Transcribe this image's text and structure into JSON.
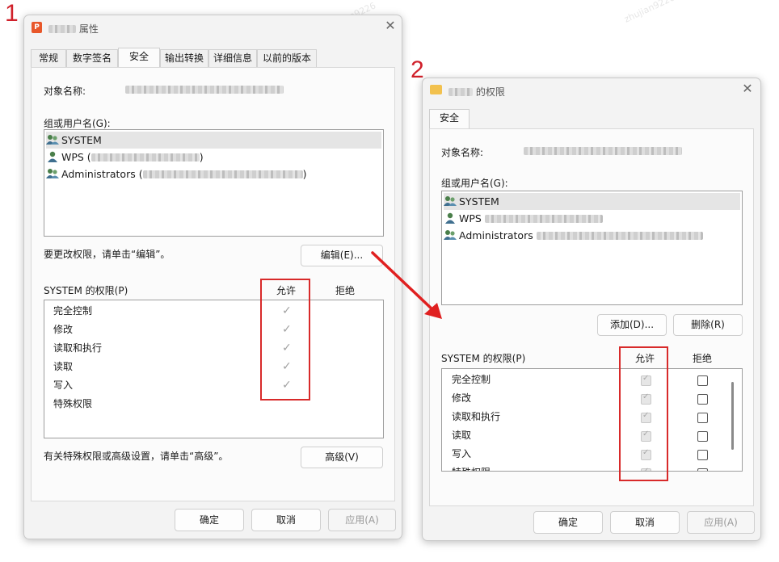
{
  "markers": {
    "one": "1",
    "two": "2"
  },
  "watermark": "zhujian9226",
  "colors": {
    "annotation_red": "#d82a2a",
    "arrow_red": "#e02020"
  },
  "window1": {
    "title_suffix": "属性",
    "tabs": [
      "常规",
      "数字签名",
      "安全",
      "输出转换",
      "详细信息",
      "以前的版本"
    ],
    "active_tab": "安全",
    "object_name_label": "对象名称:",
    "group_label": "组或用户名(G):",
    "users": [
      {
        "name": "SYSTEM",
        "icon": "group-users-icon"
      },
      {
        "name": "WPS (",
        "icon": "user-icon"
      },
      {
        "name": "Administrators (",
        "icon": "group-users-icon"
      }
    ],
    "admins_close": ")",
    "wps_close": ")",
    "change_hint": "要更改权限，请单击“编辑”。",
    "edit_button": "编辑(E)...",
    "perm_label": "SYSTEM 的权限(P)",
    "allow_header": "允许",
    "deny_header": "拒绝",
    "permissions": [
      "完全控制",
      "修改",
      "读取和执行",
      "读取",
      "写入",
      "特殊权限"
    ],
    "allowed": [
      true,
      true,
      true,
      true,
      true,
      false
    ],
    "advanced_hint": "有关特殊权限或高级设置，请单击“高级”。",
    "advanced_button": "高级(V)",
    "ok": "确定",
    "cancel": "取消",
    "apply": "应用(A)"
  },
  "window2": {
    "title_suffix": "的权限",
    "tab": "安全",
    "object_name_label": "对象名称:",
    "group_label": "组或用户名(G):",
    "users": [
      {
        "name": "SYSTEM",
        "icon": "group-users-icon"
      },
      {
        "name": "WPS",
        "icon": "user-icon"
      },
      {
        "name": "Administrators",
        "icon": "group-users-icon"
      }
    ],
    "add_button": "添加(D)...",
    "remove_button": "删除(R)",
    "perm_label": "SYSTEM 的权限(P)",
    "allow_header": "允许",
    "deny_header": "拒绝",
    "permissions": [
      "完全控制",
      "修改",
      "读取和执行",
      "读取",
      "写入",
      "特殊权限"
    ],
    "ok": "确定",
    "cancel": "取消",
    "apply": "应用(A)"
  }
}
